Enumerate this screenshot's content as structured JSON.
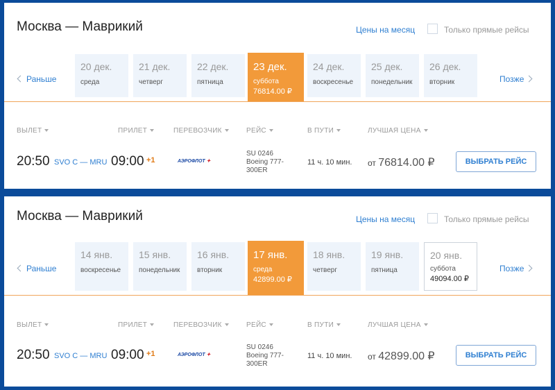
{
  "results": [
    {
      "route": "Москва — Маврикий",
      "month_link": "Цены на месяц",
      "direct_only": "Только прямые рейсы",
      "prev": "Раньше",
      "next": "Позже",
      "dates": [
        {
          "date": "20 дек.",
          "weekday": "среда",
          "price": ""
        },
        {
          "date": "21 дек.",
          "weekday": "четверг",
          "price": ""
        },
        {
          "date": "22 дек.",
          "weekday": "пятница",
          "price": ""
        },
        {
          "date": "23 дек.",
          "weekday": "суббота",
          "price": "76814.00 ₽",
          "active": true
        },
        {
          "date": "24 дек.",
          "weekday": "воскресенье",
          "price": ""
        },
        {
          "date": "25 дек.",
          "weekday": "понедельник",
          "price": ""
        },
        {
          "date": "26 дек.",
          "weekday": "вторник",
          "price": ""
        }
      ],
      "columns": {
        "departure": "ВЫЛЕТ",
        "arrival": "ПРИЛЕТ",
        "carrier": "ПЕРЕВОЗЧИК",
        "flight": "РЕЙС",
        "duration": "В ПУТИ",
        "best_price": "ЛУЧШАЯ ЦЕНА"
      },
      "flight": {
        "dep_time": "20:50",
        "airports": "SVO C — MRU",
        "arr_time": "09:00",
        "day_offset": "+1",
        "carrier_logo_text": "АЭРОФЛОТ",
        "flight_no": "SU 0246",
        "aircraft_line1": "Boeing 777-",
        "aircraft_line2": "300ER",
        "duration": "11 ч. 10 мин.",
        "price_prefix": "от",
        "price": "76814.00 ₽",
        "button": "ВЫБРАТЬ РЕЙС"
      }
    },
    {
      "route": "Москва — Маврикий",
      "month_link": "Цены на месяц",
      "direct_only": "Только прямые рейсы",
      "prev": "Раньше",
      "next": "Позже",
      "dates": [
        {
          "date": "14 янв.",
          "weekday": "воскресенье",
          "price": ""
        },
        {
          "date": "15 янв.",
          "weekday": "понедельник",
          "price": ""
        },
        {
          "date": "16 янв.",
          "weekday": "вторник",
          "price": ""
        },
        {
          "date": "17 янв.",
          "weekday": "среда",
          "price": "42899.00 ₽",
          "active": true
        },
        {
          "date": "18 янв.",
          "weekday": "четверг",
          "price": ""
        },
        {
          "date": "19 янв.",
          "weekday": "пятница",
          "price": ""
        },
        {
          "date": "20 янв.",
          "weekday": "суббота",
          "price": "49094.00 ₽",
          "outlined": true
        }
      ],
      "columns": {
        "departure": "ВЫЛЕТ",
        "arrival": "ПРИЛЕТ",
        "carrier": "ПЕРЕВОЗЧИК",
        "flight": "РЕЙС",
        "duration": "В ПУТИ",
        "best_price": "ЛУЧШАЯ ЦЕНА"
      },
      "flight": {
        "dep_time": "20:50",
        "airports": "SVO C — MRU",
        "arr_time": "09:00",
        "day_offset": "+1",
        "carrier_logo_text": "АЭРОФЛОТ",
        "flight_no": "SU 0246",
        "aircraft_line1": "Boeing 777-",
        "aircraft_line2": "300ER",
        "duration": "11 ч. 10 мин.",
        "price_prefix": "от",
        "price": "42899.00 ₽",
        "button": "ВЫБРАТЬ РЕЙС"
      }
    }
  ],
  "colors": {
    "accent": "#f29a3a",
    "link": "#2f7fd1",
    "background": "#0b4b9a",
    "date_bg": "#eef4fb"
  }
}
